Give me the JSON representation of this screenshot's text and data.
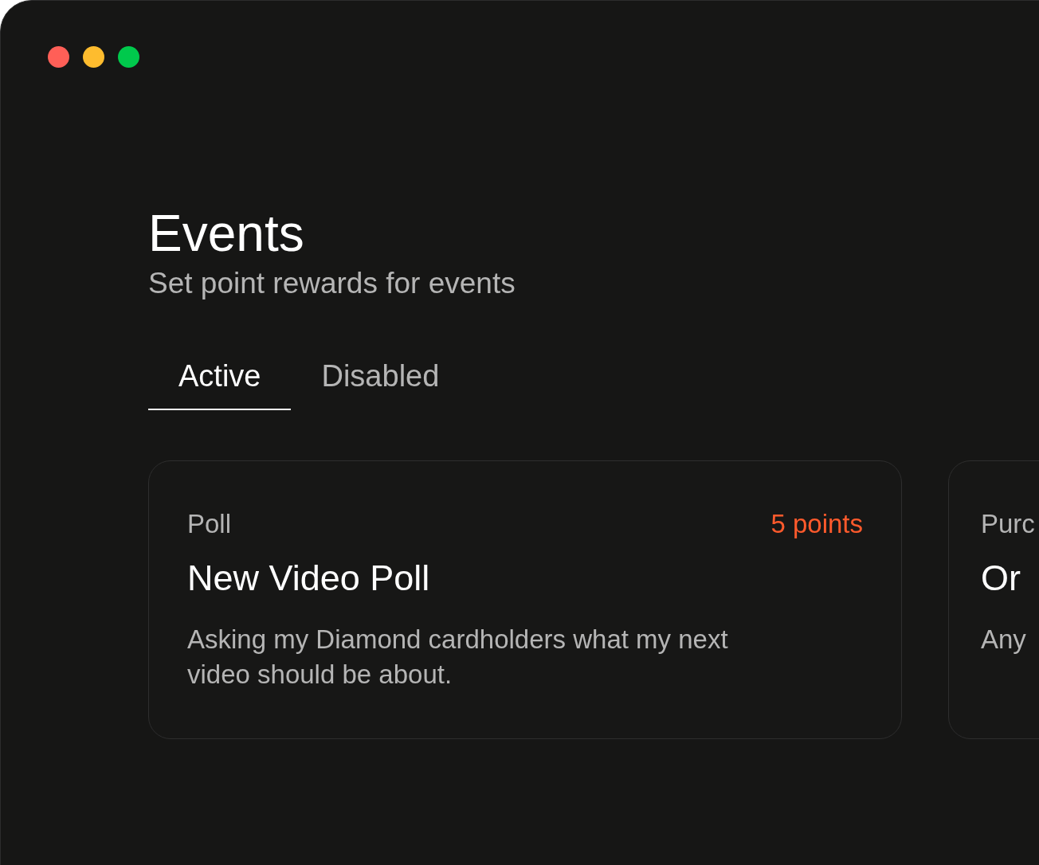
{
  "page": {
    "title": "Events",
    "subtitle": "Set point rewards for events"
  },
  "tabs": [
    {
      "label": "Active",
      "selected": true
    },
    {
      "label": "Disabled",
      "selected": false
    }
  ],
  "cards": [
    {
      "category": "Poll",
      "points": "5 points",
      "title": "New Video Poll",
      "description": "Asking my Diamond cardholders what my next video should be about."
    },
    {
      "category": "Purc",
      "title": "Or",
      "description": "Any"
    }
  ]
}
